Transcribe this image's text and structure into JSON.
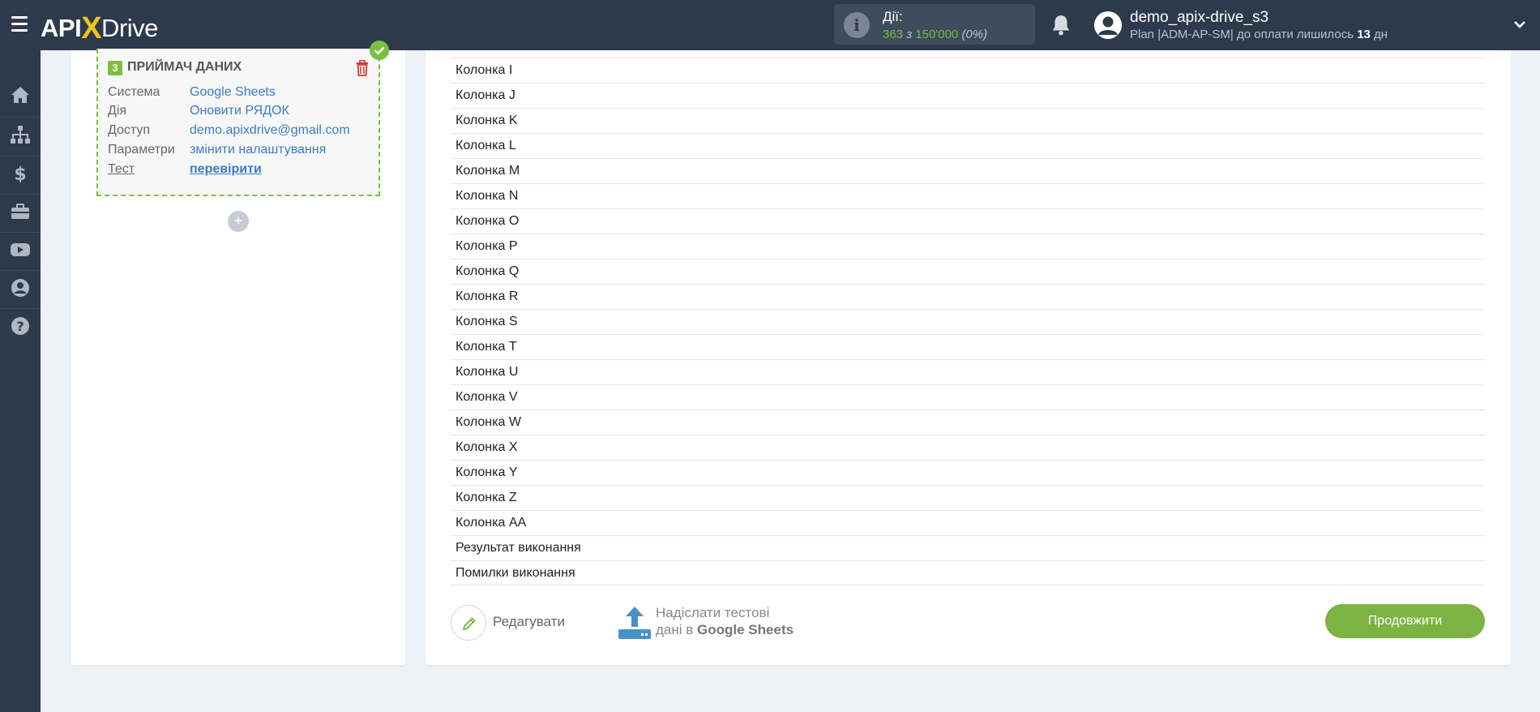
{
  "header": {
    "logo": {
      "api": "API",
      "x": "X",
      "drive": "Drive"
    },
    "actions": {
      "label": "Дії:",
      "used": "363",
      "sep": " з ",
      "limit": "150'000",
      "percent": "(0%)"
    },
    "user": {
      "name": "demo_apix-drive_s3",
      "plan_prefix": "Plan |ADM-AP-SM| до оплати лишилось ",
      "days": "13",
      "days_suffix": " дн"
    }
  },
  "receiver": {
    "step": "3",
    "title": "ПРИЙМАЧ ДАНИХ",
    "fields": [
      {
        "key": "Система",
        "value": "Google Sheets"
      },
      {
        "key": "Дія",
        "value": "Оновити РЯДОК"
      },
      {
        "key": "Доступ",
        "value": "demo.apixdrive@gmail.com"
      },
      {
        "key": "Параметри",
        "value": "змінити налаштування"
      },
      {
        "key": "Тест",
        "value": "перевірити"
      }
    ],
    "add": "+"
  },
  "columns": [
    "Колонка I",
    "Колонка J",
    "Колонка K",
    "Колонка L",
    "Колонка M",
    "Колонка N",
    "Колонка O",
    "Колонка P",
    "Колонка Q",
    "Колонка R",
    "Колонка S",
    "Колонка T",
    "Колонка U",
    "Колонка V",
    "Колонка W",
    "Колонка X",
    "Колонка Y",
    "Колонка Z",
    "Колонка AA",
    "Результат виконання",
    "Помилки виконання"
  ],
  "footer": {
    "edit_label": "Редагувати",
    "send_line1": "Надіслати тестові",
    "send_line2_prefix": "дані в ",
    "send_line2_bold": "Google Sheets",
    "continue_label": "Продовжити"
  },
  "colors": {
    "topbar": "#2d3a4b",
    "accent_green": "#7cb342",
    "link_blue": "#3b7cc4"
  },
  "icons": [
    "menu-icon",
    "info-icon",
    "bell-icon",
    "user-icon",
    "chevron-down-icon",
    "home-icon",
    "sitemap-icon",
    "dollar-icon",
    "briefcase-icon",
    "youtube-icon",
    "account-icon",
    "help-icon",
    "check-icon",
    "trash-icon",
    "pencil-icon",
    "upload-icon"
  ]
}
